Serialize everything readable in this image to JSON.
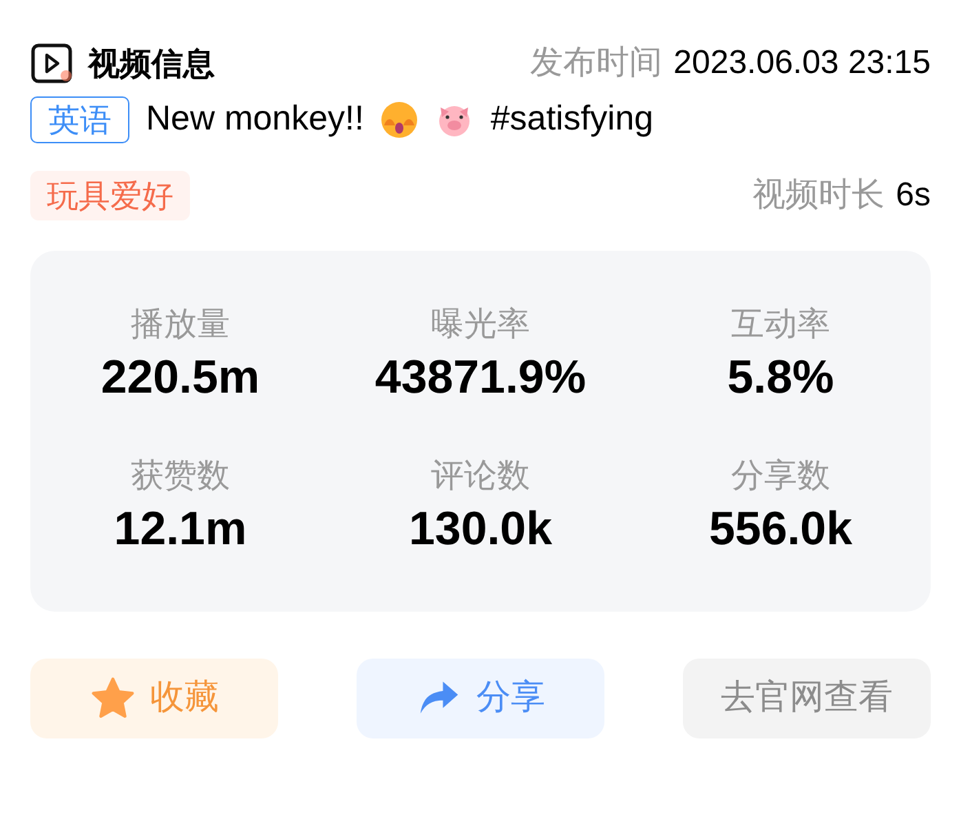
{
  "header": {
    "title": "视频信息",
    "publish_label": "发布时间",
    "publish_time": "2023.06.03 23:15"
  },
  "video": {
    "language_tag": "英语",
    "caption_start": "New monkey!!",
    "caption_hashtag": "#satisfying"
  },
  "category_tag": "玩具爱好",
  "duration": {
    "label": "视频时长",
    "value": "6s"
  },
  "stats": [
    {
      "label": "播放量",
      "value": "220.5m"
    },
    {
      "label": "曝光率",
      "value": "43871.9%"
    },
    {
      "label": "互动率",
      "value": "5.8%"
    },
    {
      "label": "获赞数",
      "value": "12.1m"
    },
    {
      "label": "评论数",
      "value": "130.0k"
    },
    {
      "label": "分享数",
      "value": "556.0k"
    }
  ],
  "buttons": [
    {
      "kind": "collect",
      "label": "收藏"
    },
    {
      "kind": "share",
      "label": "分享"
    },
    {
      "kind": "visit",
      "label": "去官网查看"
    }
  ]
}
